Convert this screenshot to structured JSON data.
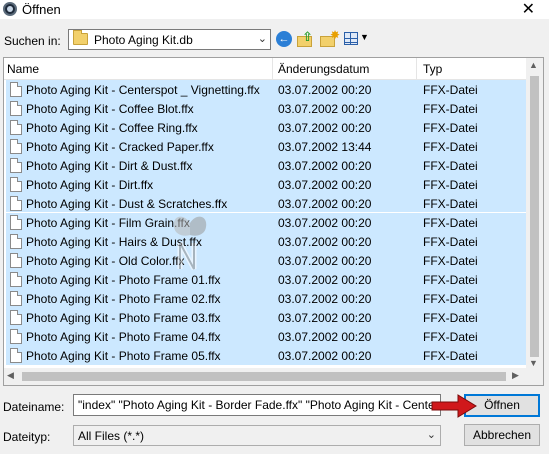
{
  "window": {
    "title": "Öffnen",
    "close_glyph": "✕"
  },
  "lookin": {
    "label": "Suchen in:",
    "value": "Photo Aging Kit.db"
  },
  "toolbar": {
    "back_icon": "back-arrow-icon",
    "up_icon": "folder-up-icon",
    "new_folder_icon": "new-folder-icon",
    "views_icon": "view-menu-icon"
  },
  "columns": {
    "name": "Name",
    "date": "Änderungsdatum",
    "type": "Typ"
  },
  "files": [
    {
      "name": "Photo Aging Kit - Centerspot _ Vignetting.ffx",
      "date": "03.07.2002 00:20",
      "type": "FFX-Datei"
    },
    {
      "name": "Photo Aging Kit - Coffee Blot.ffx",
      "date": "03.07.2002 00:20",
      "type": "FFX-Datei"
    },
    {
      "name": "Photo Aging Kit - Coffee Ring.ffx",
      "date": "03.07.2002 00:20",
      "type": "FFX-Datei"
    },
    {
      "name": "Photo Aging Kit - Cracked Paper.ffx",
      "date": "03.07.2002 13:44",
      "type": "FFX-Datei"
    },
    {
      "name": "Photo Aging Kit - Dirt & Dust.ffx",
      "date": "03.07.2002 00:20",
      "type": "FFX-Datei"
    },
    {
      "name": "Photo Aging Kit - Dirt.ffx",
      "date": "03.07.2002 00:20",
      "type": "FFX-Datei"
    },
    {
      "name": "Photo Aging Kit - Dust & Scratches.ffx",
      "date": "03.07.2002 00:20",
      "type": "FFX-Datei"
    },
    {
      "name": "Photo Aging Kit - Film Grain.ffx",
      "date": "03.07.2002 00:20",
      "type": "FFX-Datei"
    },
    {
      "name": "Photo Aging Kit - Hairs & Dust.ffx",
      "date": "03.07.2002 00:20",
      "type": "FFX-Datei"
    },
    {
      "name": "Photo Aging Kit - Old Color.ffx",
      "date": "03.07.2002 00:20",
      "type": "FFX-Datei"
    },
    {
      "name": "Photo Aging Kit - Photo Frame 01.ffx",
      "date": "03.07.2002 00:20",
      "type": "FFX-Datei"
    },
    {
      "name": "Photo Aging Kit - Photo Frame 02.ffx",
      "date": "03.07.2002 00:20",
      "type": "FFX-Datei"
    },
    {
      "name": "Photo Aging Kit - Photo Frame 03.ffx",
      "date": "03.07.2002 00:20",
      "type": "FFX-Datei"
    },
    {
      "name": "Photo Aging Kit - Photo Frame 04.ffx",
      "date": "03.07.2002 00:20",
      "type": "FFX-Datei"
    },
    {
      "name": "Photo Aging Kit - Photo Frame 05.ffx",
      "date": "03.07.2002 00:20",
      "type": "FFX-Datei"
    }
  ],
  "filename": {
    "label": "Dateiname:",
    "value": "\"index\" \"Photo Aging Kit - Border Fade.ffx\" \"Photo Aging Kit - Centerspot _ Vi"
  },
  "filetype": {
    "label": "Dateityp:",
    "value": "All Files (*.*)"
  },
  "buttons": {
    "open": "Öffnen",
    "cancel": "Abbrechen"
  },
  "colors": {
    "selection": "#cce8ff",
    "accent": "#0078d7",
    "annotation_arrow": "#d0181b"
  }
}
